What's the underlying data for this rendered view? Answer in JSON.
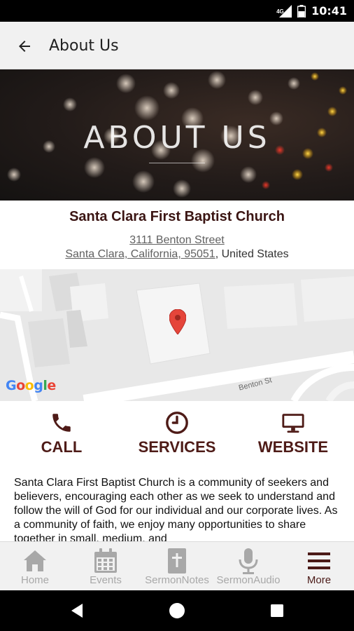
{
  "status_bar": {
    "time": "10:41",
    "network_label": "4G",
    "icons": [
      "signal-icon",
      "battery-icon"
    ]
  },
  "toolbar": {
    "title": "About Us",
    "back_icon": "arrow-left-icon"
  },
  "hero": {
    "title": "ABOUT US"
  },
  "organization": {
    "name": "Santa Clara First Baptist Church",
    "street": "3111 Benton Street",
    "city_state_zip": "Santa Clara, California, 95051",
    "country": "United States"
  },
  "map": {
    "logo_text": "Google",
    "street_label": "Benton St",
    "pin_icon": "map-pin-icon"
  },
  "actions": [
    {
      "label": "CALL",
      "icon": "phone-icon"
    },
    {
      "label": "SERVICES",
      "icon": "clock-icon"
    },
    {
      "label": "WEBSITE",
      "icon": "monitor-icon"
    }
  ],
  "description": "Santa Clara First Baptist Church is a community of seekers and believers, encouraging each other as we seek to understand and follow the will of God for our individual and our corporate lives. As a community of faith, we enjoy many opportunities to share together in small, medium, and",
  "bottom_nav": {
    "items": [
      {
        "label": "Home",
        "icon": "home-icon",
        "active": false
      },
      {
        "label": "Events",
        "icon": "calendar-icon",
        "active": false
      },
      {
        "label": "SermonNotes",
        "icon": "bible-icon",
        "active": false
      },
      {
        "label": "SermonAudio",
        "icon": "microphone-icon",
        "active": false
      },
      {
        "label": "More",
        "icon": "menu-icon",
        "active": true
      }
    ]
  },
  "system_nav": {
    "icons": [
      "back-triangle-icon",
      "home-circle-icon",
      "recents-square-icon"
    ]
  },
  "colors": {
    "accent": "#4e1b17",
    "toolbar_bg": "#f1f1f1",
    "nav_inactive": "#a8a8a8"
  }
}
